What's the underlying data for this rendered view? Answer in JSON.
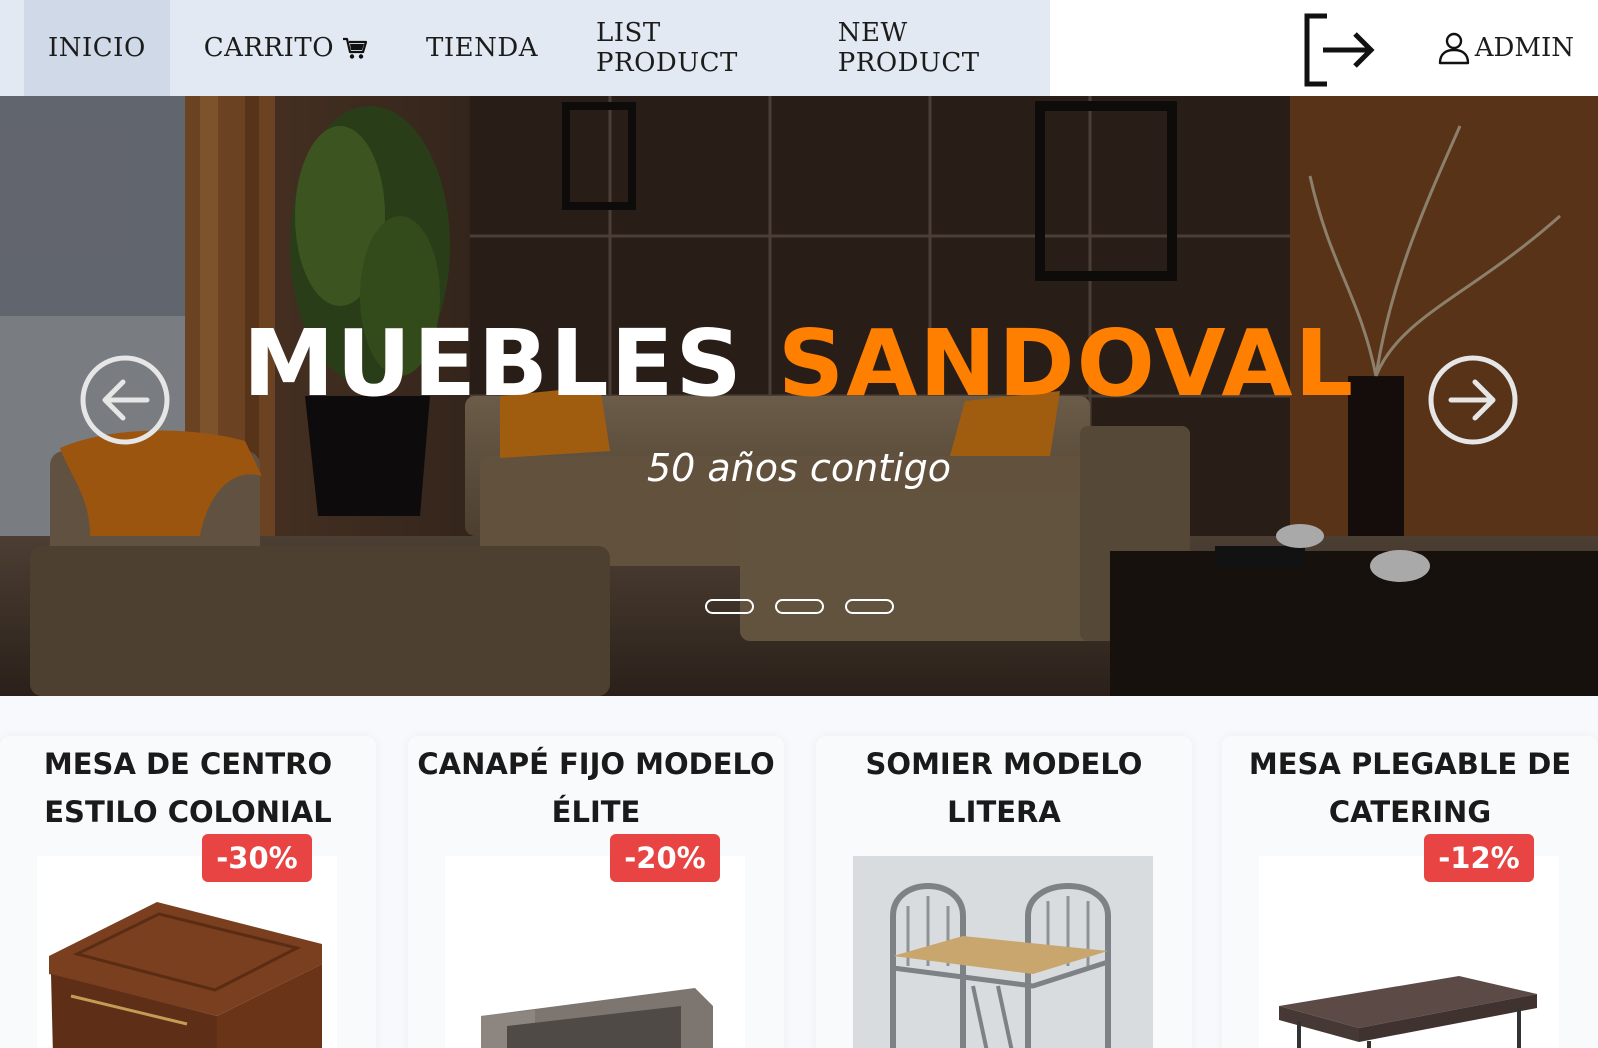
{
  "nav": {
    "items": [
      {
        "label": "INICIO"
      },
      {
        "label": "CARRITO"
      },
      {
        "label": "TIENDA"
      },
      {
        "label": "LIST PRODUCT"
      },
      {
        "label": "NEW PRODUCT"
      }
    ],
    "admin_label": "ADMIN",
    "icons": {
      "cart": "cart-icon",
      "logout": "logout-icon",
      "user": "user-icon"
    }
  },
  "hero": {
    "title_white": "MUEBLES",
    "title_orange": "SANDOVAL",
    "subtitle": "50 años contigo",
    "slides": 3,
    "active_slide": 1,
    "colors": {
      "accent": "#ff7f00",
      "title": "#ffffff"
    }
  },
  "products": [
    {
      "title": "MESA DE CENTRO ESTILO COLONIAL",
      "discount": "-30%"
    },
    {
      "title": "CANAPÉ FIJO MODELO ÉLITE",
      "discount": "-20%"
    },
    {
      "title": "SOMIER MODELO LITERA",
      "discount": ""
    },
    {
      "title": "MESA PLEGABLE DE CATERING",
      "discount": "-12%"
    }
  ],
  "colors": {
    "nav_bg": "#e3e9f2",
    "nav_active": "#cfd9e7",
    "badge": "#e84444",
    "page_bg": "#f7f9fc"
  }
}
